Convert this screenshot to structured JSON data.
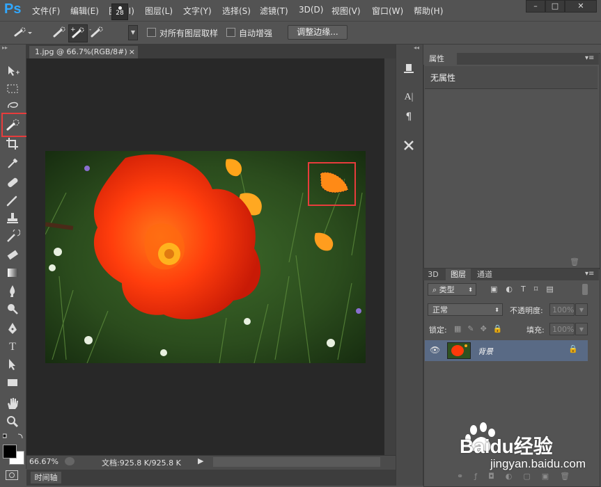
{
  "app": {
    "logo": "Ps"
  },
  "menubar": {
    "items": [
      {
        "label": "文件(F)",
        "x": 0
      },
      {
        "label": "编辑(E)"
      },
      {
        "label": "图像(I)"
      },
      {
        "label": "图层(L)"
      },
      {
        "label": "文字(Y)"
      },
      {
        "label": "选择(S)"
      },
      {
        "label": "滤镜(T)"
      },
      {
        "label": "3D(D)"
      },
      {
        "label": "视图(V)"
      },
      {
        "label": "窗口(W)"
      },
      {
        "label": "帮助(H)"
      }
    ],
    "window_controls": [
      "–",
      "□",
      "✕"
    ]
  },
  "options_bar": {
    "brush_size": "28",
    "sample_all_layers": "对所有图层取样",
    "auto_enhance": "自动增强",
    "refine_edge": "调整边缘..."
  },
  "document": {
    "tab_title": "1.jpg @ 66.7%(RGB/8#)",
    "close": "×"
  },
  "status": {
    "zoom": "66.67%",
    "doc_info": "文档:925.8 K/925.8 K"
  },
  "timeline": {
    "label": "时间轴"
  },
  "properties": {
    "tab": "属性",
    "body": "无属性"
  },
  "layers_panel": {
    "tabs": [
      "3D",
      "图层",
      "通道"
    ],
    "filter_kind": "类型",
    "blend_mode": "正常",
    "opacity_label": "不透明度:",
    "opacity_value": "100%",
    "lock_label": "锁定:",
    "fill_label": "填充:",
    "fill_value": "100%",
    "layer_name": "背景"
  },
  "watermark": {
    "brand": "Baidu经验",
    "url": "jingyan.baidu.com"
  },
  "colors": {
    "highlight": "#e83c3c",
    "ps_blue": "#31a8ff",
    "layer_selected": "#596a85"
  }
}
